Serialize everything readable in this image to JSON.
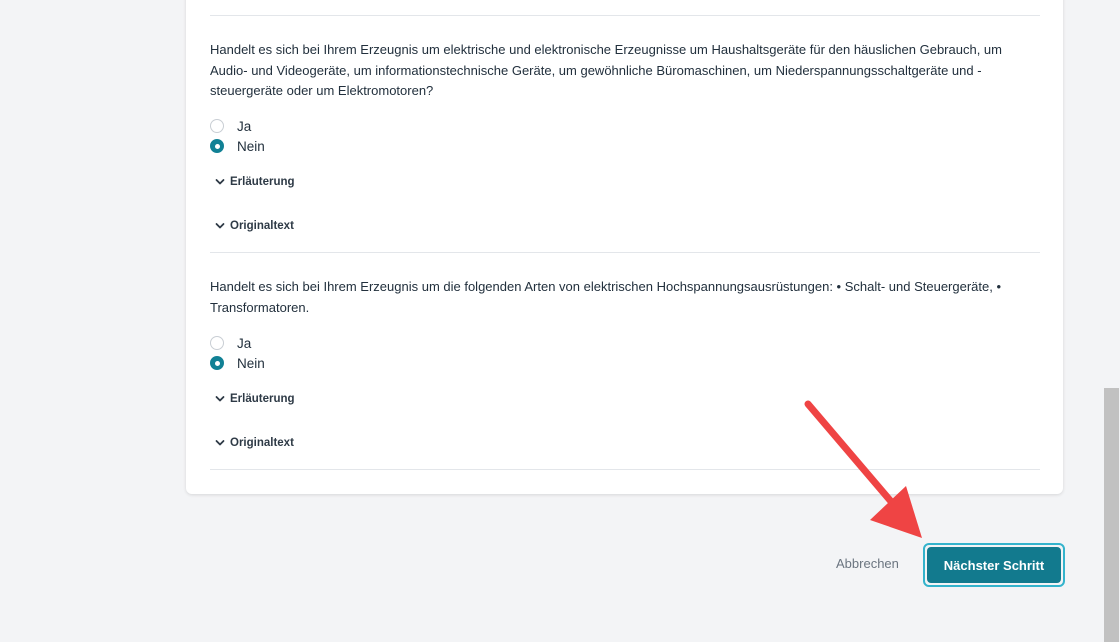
{
  "questions": [
    {
      "text": "Handelt es sich bei Ihrem Erzeugnis um elektrische und elektronische Erzeugnisse um Haushaltsgeräte für den häuslichen Gebrauch, um Audio- und Videogeräte, um informationstechnische Geräte, um gewöhnliche Büromaschinen, um Niederspannungsschaltgeräte und -steuergeräte oder um Elektromotoren?",
      "options": [
        {
          "label": "Ja",
          "checked": false
        },
        {
          "label": "Nein",
          "checked": true
        }
      ],
      "explanation_label": "Erläuterung",
      "original_label": "Originaltext"
    },
    {
      "text": "Handelt es sich bei Ihrem Erzeugnis um die folgenden Arten von elektrischen Hochspannungsausrüstungen: • Schalt- und Steuergeräte, • Transformatoren.",
      "options": [
        {
          "label": "Ja",
          "checked": false
        },
        {
          "label": "Nein",
          "checked": true
        }
      ],
      "explanation_label": "Erläuterung",
      "original_label": "Originaltext"
    }
  ],
  "footer": {
    "cancel_label": "Abbrechen",
    "next_label": "Nächster Schritt"
  },
  "colors": {
    "accent": "#127a8e",
    "focus_ring": "#33b3cc",
    "annotation_arrow": "#ef4444"
  },
  "icons": {
    "expand": "chevron-down-icon",
    "annotation": "red-arrow-icon"
  }
}
